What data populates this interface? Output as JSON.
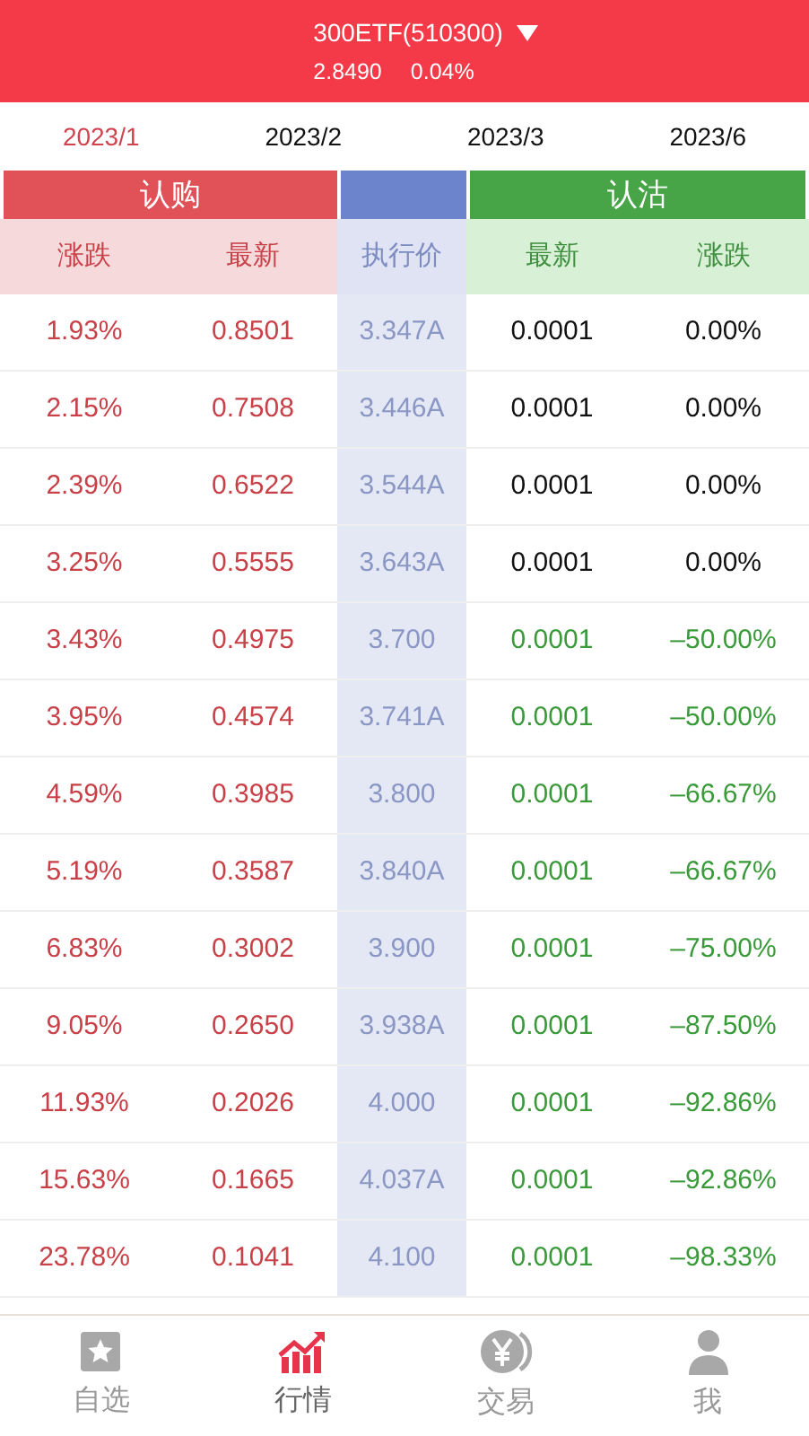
{
  "header": {
    "title": "300ETF(510300)",
    "price": "2.8490",
    "change": "0.04%"
  },
  "tabs": [
    {
      "label": "2023/1",
      "selected": true
    },
    {
      "label": "2023/2",
      "selected": false
    },
    {
      "label": "2023/3",
      "selected": false
    },
    {
      "label": "2023/6",
      "selected": false
    }
  ],
  "groups": {
    "call": "认购",
    "put": "认沽"
  },
  "columns": [
    "涨跌",
    "最新",
    "执行价",
    "最新",
    "涨跌"
  ],
  "rows": [
    {
      "kind": "flat",
      "call_change": "1.93%",
      "call_last": "0.8501",
      "strike": "3.347A",
      "put_last": "0.0001",
      "put_change": "0.00%"
    },
    {
      "kind": "flat",
      "call_change": "2.15%",
      "call_last": "0.7508",
      "strike": "3.446A",
      "put_last": "0.0001",
      "put_change": "0.00%"
    },
    {
      "kind": "flat",
      "call_change": "2.39%",
      "call_last": "0.6522",
      "strike": "3.544A",
      "put_last": "0.0001",
      "put_change": "0.00%"
    },
    {
      "kind": "flat",
      "call_change": "3.25%",
      "call_last": "0.5555",
      "strike": "3.643A",
      "put_last": "0.0001",
      "put_change": "0.00%"
    },
    {
      "kind": "down",
      "call_change": "3.43%",
      "call_last": "0.4975",
      "strike": "3.700",
      "put_last": "0.0001",
      "put_change": "–50.00%"
    },
    {
      "kind": "down",
      "call_change": "3.95%",
      "call_last": "0.4574",
      "strike": "3.741A",
      "put_last": "0.0001",
      "put_change": "–50.00%"
    },
    {
      "kind": "down",
      "call_change": "4.59%",
      "call_last": "0.3985",
      "strike": "3.800",
      "put_last": "0.0001",
      "put_change": "–66.67%"
    },
    {
      "kind": "down",
      "call_change": "5.19%",
      "call_last": "0.3587",
      "strike": "3.840A",
      "put_last": "0.0001",
      "put_change": "–66.67%"
    },
    {
      "kind": "down",
      "call_change": "6.83%",
      "call_last": "0.3002",
      "strike": "3.900",
      "put_last": "0.0001",
      "put_change": "–75.00%"
    },
    {
      "kind": "down",
      "call_change": "9.05%",
      "call_last": "0.2650",
      "strike": "3.938A",
      "put_last": "0.0001",
      "put_change": "–87.50%"
    },
    {
      "kind": "down",
      "call_change": "11.93%",
      "call_last": "0.2026",
      "strike": "4.000",
      "put_last": "0.0001",
      "put_change": "–92.86%"
    },
    {
      "kind": "down",
      "call_change": "15.63%",
      "call_last": "0.1665",
      "strike": "4.037A",
      "put_last": "0.0001",
      "put_change": "–92.86%"
    },
    {
      "kind": "down",
      "call_change": "23.78%",
      "call_last": "0.1041",
      "strike": "4.100",
      "put_last": "0.0001",
      "put_change": "–98.33%"
    }
  ],
  "nav": [
    {
      "kind": "star",
      "label": "自选",
      "selected": false
    },
    {
      "kind": "chart",
      "label": "行情",
      "selected": true
    },
    {
      "kind": "yen",
      "label": "交易",
      "selected": false
    },
    {
      "kind": "person",
      "label": "我",
      "selected": false
    }
  ]
}
